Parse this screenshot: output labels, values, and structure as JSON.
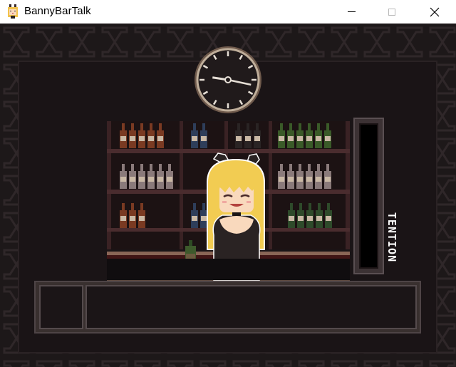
{
  "window": {
    "title": "BannyBarTalk",
    "icon": "bunny-girl-app-icon",
    "controls": [
      "minimize-icon",
      "maximize-icon",
      "close-icon"
    ]
  },
  "game": {
    "clock": {
      "hour": 9,
      "minute": 17
    },
    "tension": {
      "label": "TENTION",
      "level": 0
    },
    "dialogue": {
      "name": "",
      "text": ""
    }
  },
  "colors": {
    "wall_dark": "#1d1819",
    "wall_pattern": "#2e2628",
    "shelf_wood": "#3a2224",
    "counter_wood": "#401515",
    "counter_top": "#8a6656",
    "hair": "#f2cc52",
    "dress": "#2a2323",
    "tension_frame": "#3c3234"
  }
}
